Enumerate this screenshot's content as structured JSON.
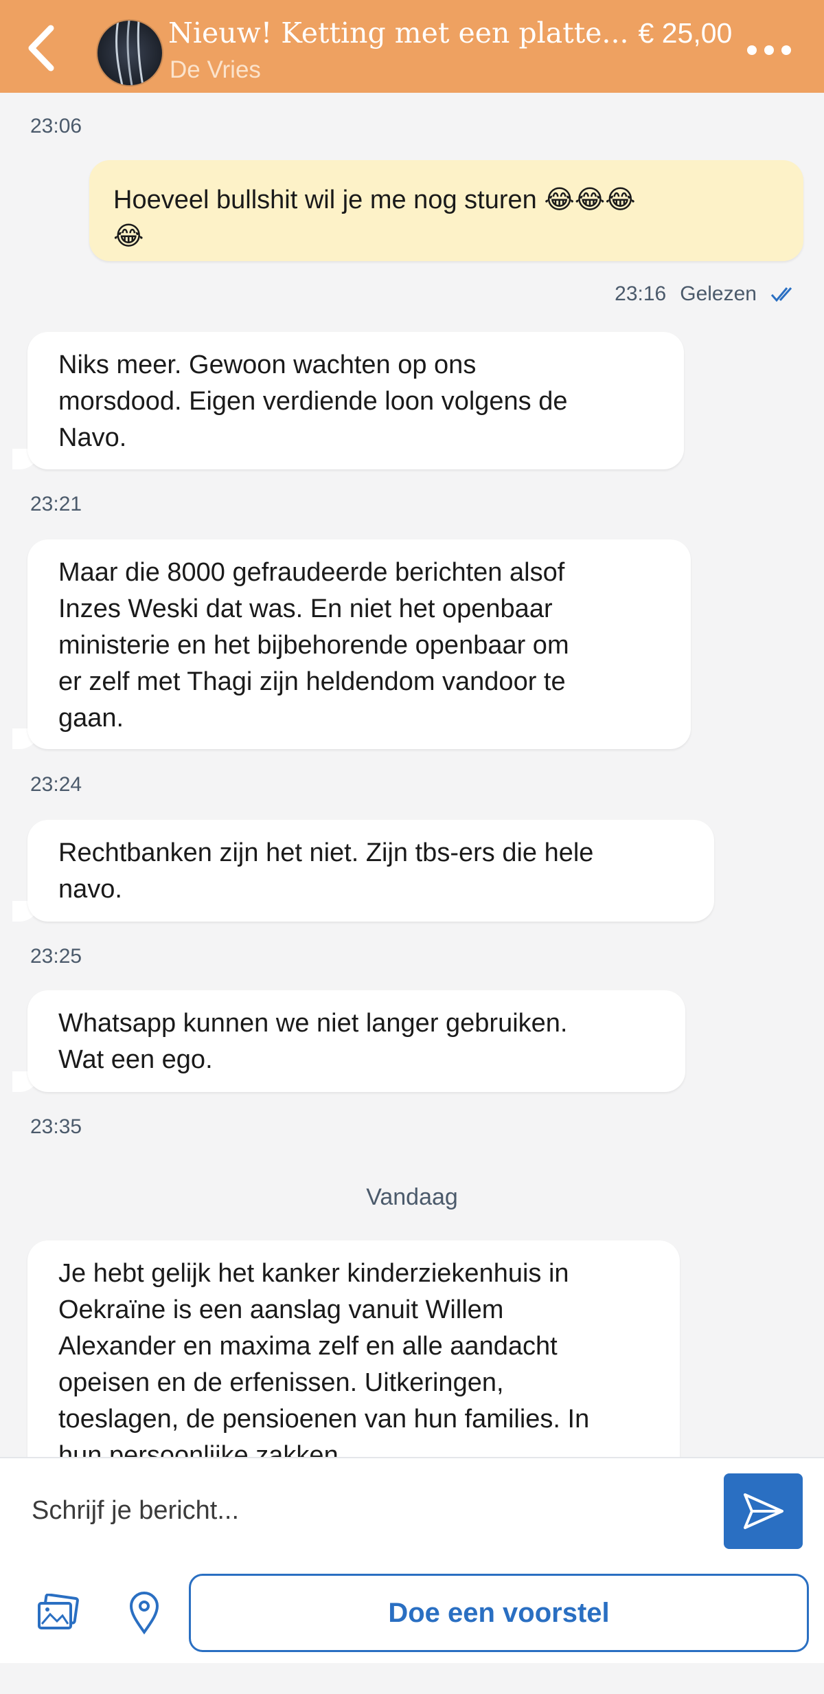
{
  "header": {
    "title": "Nieuw! Ketting met een platte...",
    "price": "€ 25,00",
    "seller": "De Vries"
  },
  "colors": {
    "header_bg": "#eea161",
    "accent_blue": "#2a6fc2",
    "outgoing_bubble": "#fdf2c8",
    "incoming_bubble": "#ffffff"
  },
  "messages": [
    {
      "time": "23:06",
      "direction": "out",
      "text": "Hoeveel bullshit wil je me nog sturen 😂😂😂\n😂"
    },
    {
      "time": "23:16",
      "status": "Gelezen",
      "direction": "in",
      "text": "Niks meer. Gewoon wachten op ons\nmorsdood. Eigen verdiende loon volgens de\nNavo."
    },
    {
      "time": "23:21",
      "direction": "in",
      "text": "Maar die 8000 gefraudeerde berichten alsof\nInzes Weski dat was. En niet het openbaar\nministerie en het bijbehorende openbaar om\ner zelf met Thagi zijn heldendom vandoor te\ngaan."
    },
    {
      "time": "23:24",
      "direction": "in",
      "text": "Rechtbanken zijn het niet. Zijn tbs-ers die hele\nnavo."
    },
    {
      "time": "23:25",
      "direction": "in",
      "text": "Whatsapp kunnen we niet langer gebruiken.\nWat een ego."
    },
    {
      "time": "23:35",
      "direction": "in",
      "text": "Je hebt gelijk het kanker kinderziekenhuis in\nOekraïne is een aanslag vanuit Willem\nAlexander en maxima zelf en alle aandacht\nopeisen en de erfenissen. Uitkeringen,\ntoeslagen, de pensioenen van hun families. In\nhun persoonlijke zakken"
    }
  ],
  "day_separator": "Vandaag",
  "composer": {
    "placeholder": "Schrijf je bericht..."
  },
  "actions": {
    "offer_label": "Doe een voorstel"
  },
  "icons": [
    "back-arrow-icon",
    "more-dots-icon",
    "send-icon",
    "image-gallery-icon",
    "location-pin-icon",
    "double-check-icon"
  ]
}
